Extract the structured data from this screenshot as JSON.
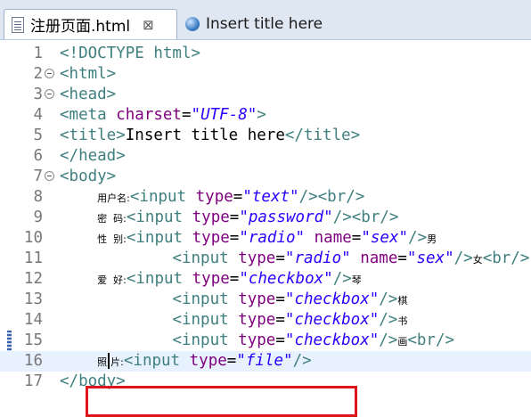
{
  "tabs": [
    {
      "label": "注册页面.html",
      "close": "⊠"
    },
    {
      "label": "Insert title here"
    }
  ],
  "editor": {
    "lines": [
      {
        "n": "1",
        "segs": [
          [
            "t",
            "<!DOCTYPE html>"
          ]
        ]
      },
      {
        "n": "2",
        "fold": true,
        "segs": [
          [
            "t",
            "<html>"
          ]
        ]
      },
      {
        "n": "3",
        "fold": true,
        "segs": [
          [
            "t",
            "<head>"
          ]
        ]
      },
      {
        "n": "4",
        "segs": [
          [
            "t",
            "<meta "
          ],
          [
            "a",
            "charset"
          ],
          [
            "x",
            "="
          ],
          [
            "v",
            "\"UTF-8\""
          ],
          [
            "t",
            ">"
          ]
        ]
      },
      {
        "n": "5",
        "segs": [
          [
            "t",
            "<title>"
          ],
          [
            "x",
            "Insert title here"
          ],
          [
            "t",
            "</title>"
          ]
        ]
      },
      {
        "n": "6",
        "segs": [
          [
            "t",
            "</head>"
          ]
        ]
      },
      {
        "n": "7",
        "fold": true,
        "segs": [
          [
            "t",
            "<body>"
          ]
        ]
      },
      {
        "n": "8",
        "segs": [
          [
            "x",
            "    "
          ],
          [
            "cjk",
            "用户名:"
          ],
          [
            "t",
            "<input "
          ],
          [
            "a",
            "type"
          ],
          [
            "x",
            "="
          ],
          [
            "v",
            "\"text\""
          ],
          [
            "t",
            "/><br/>"
          ]
        ]
      },
      {
        "n": "9",
        "segs": [
          [
            "x",
            "    "
          ],
          [
            "cjk",
            "密  码:"
          ],
          [
            "t",
            "<input "
          ],
          [
            "a",
            "type"
          ],
          [
            "x",
            "="
          ],
          [
            "v",
            "\"password\""
          ],
          [
            "t",
            "/><br/>"
          ]
        ]
      },
      {
        "n": "10",
        "segs": [
          [
            "x",
            "    "
          ],
          [
            "cjk",
            "性  别:"
          ],
          [
            "t",
            "<input "
          ],
          [
            "a",
            "type"
          ],
          [
            "x",
            "="
          ],
          [
            "v",
            "\"radio\""
          ],
          [
            "x",
            " "
          ],
          [
            "a",
            "name"
          ],
          [
            "x",
            "="
          ],
          [
            "v",
            "\"sex\""
          ],
          [
            "t",
            "/>"
          ],
          [
            "cjk",
            "男"
          ]
        ]
      },
      {
        "n": "11",
        "segs": [
          [
            "x",
            "            "
          ],
          [
            "t",
            "<input "
          ],
          [
            "a",
            "type"
          ],
          [
            "x",
            "="
          ],
          [
            "v",
            "\"radio\""
          ],
          [
            "x",
            " "
          ],
          [
            "a",
            "name"
          ],
          [
            "x",
            "="
          ],
          [
            "v",
            "\"sex\""
          ],
          [
            "t",
            "/>"
          ],
          [
            "cjk",
            "女"
          ],
          [
            "t",
            "<br/>"
          ]
        ]
      },
      {
        "n": "12",
        "segs": [
          [
            "x",
            "    "
          ],
          [
            "cjk",
            "爱  好:"
          ],
          [
            "t",
            "<input "
          ],
          [
            "a",
            "type"
          ],
          [
            "x",
            "="
          ],
          [
            "v",
            "\"checkbox\""
          ],
          [
            "t",
            "/>"
          ],
          [
            "cjk",
            "琴"
          ]
        ]
      },
      {
        "n": "13",
        "segs": [
          [
            "x",
            "            "
          ],
          [
            "t",
            "<input "
          ],
          [
            "a",
            "type"
          ],
          [
            "x",
            "="
          ],
          [
            "v",
            "\"checkbox\""
          ],
          [
            "t",
            "/>"
          ],
          [
            "cjk",
            "棋"
          ]
        ]
      },
      {
        "n": "14",
        "segs": [
          [
            "x",
            "            "
          ],
          [
            "t",
            "<input "
          ],
          [
            "a",
            "type"
          ],
          [
            "x",
            "="
          ],
          [
            "v",
            "\"checkbox\""
          ],
          [
            "t",
            "/>"
          ],
          [
            "cjk",
            "书"
          ]
        ]
      },
      {
        "n": "15",
        "segs": [
          [
            "x",
            "            "
          ],
          [
            "t",
            "<input "
          ],
          [
            "a",
            "type"
          ],
          [
            "x",
            "="
          ],
          [
            "v",
            "\"checkbox\""
          ],
          [
            "t",
            "/>"
          ],
          [
            "cjk",
            "画"
          ],
          [
            "t",
            "<br/>"
          ]
        ]
      },
      {
        "n": "16",
        "current": true,
        "segs": [
          [
            "x",
            "    "
          ],
          [
            "cjk",
            "照"
          ],
          [
            "cursor",
            ""
          ],
          [
            "cjk",
            "片:"
          ],
          [
            "t",
            "<input "
          ],
          [
            "a",
            "type"
          ],
          [
            "x",
            "="
          ],
          [
            "v",
            "\"file\""
          ],
          [
            "t",
            "/>"
          ]
        ]
      },
      {
        "n": "17",
        "segs": [
          [
            "t",
            "</body>"
          ]
        ]
      }
    ]
  },
  "colors": {
    "tag": "#3f7f7f",
    "attr": "#7f007f",
    "value": "#2a00ff",
    "highlight_box": "#e0141b"
  }
}
